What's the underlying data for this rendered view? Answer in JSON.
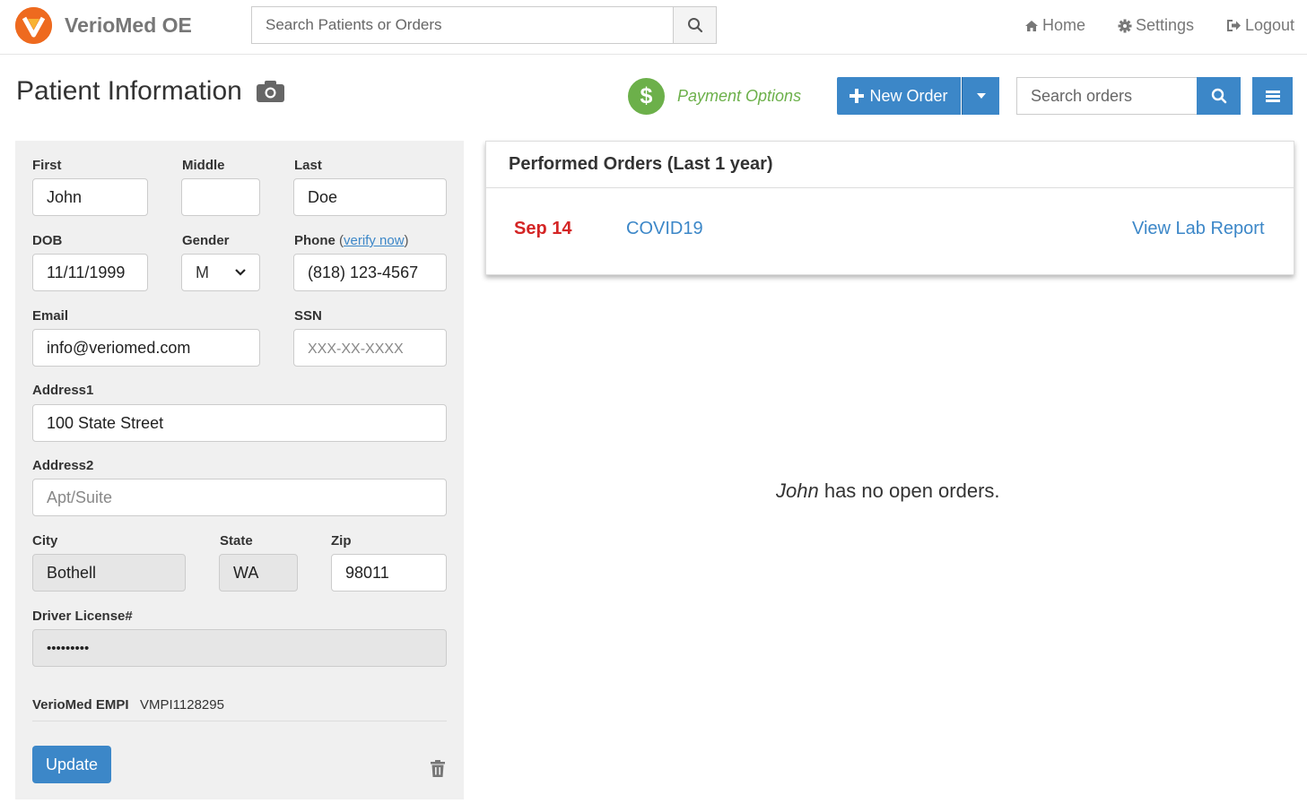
{
  "app": {
    "brand": "VerioMed OE"
  },
  "topbar": {
    "search_placeholder": "Search Patients or Orders",
    "nav": {
      "home": "Home",
      "settings": "Settings",
      "logout": "Logout"
    }
  },
  "header": {
    "title": "Patient Information",
    "payment_options": "Payment Options",
    "payment_icon": "$",
    "new_order": "New Order",
    "orders_search_placeholder": "Search orders"
  },
  "form": {
    "first": {
      "label": "First",
      "value": "John"
    },
    "middle": {
      "label": "Middle",
      "value": ""
    },
    "last": {
      "label": "Last",
      "value": "Doe"
    },
    "dob": {
      "label": "DOB",
      "value": "11/11/1999"
    },
    "gender": {
      "label": "Gender",
      "value": "M"
    },
    "phone": {
      "label": "Phone",
      "verify_open": "(",
      "verify_link": "verify now",
      "verify_close": ")",
      "value": "(818) 123-4567"
    },
    "email": {
      "label": "Email",
      "value": "info@veriomed.com"
    },
    "ssn": {
      "label": "SSN",
      "placeholder": "XXX-XX-XXXX"
    },
    "address1": {
      "label": "Address1",
      "value": "100 State Street"
    },
    "address2": {
      "label": "Address2",
      "placeholder": "Apt/Suite"
    },
    "city": {
      "label": "City",
      "value": "Bothell"
    },
    "state": {
      "label": "State",
      "value": "WA"
    },
    "zip": {
      "label": "Zip",
      "value": "98011"
    },
    "license": {
      "label": "Driver License#",
      "value": "•••••••••"
    },
    "empi": {
      "label": "VerioMed EMPI",
      "value": "VMPI1128295"
    },
    "update_label": "Update"
  },
  "performed_orders": {
    "title": "Performed Orders (Last 1 year)",
    "items": [
      {
        "date": "Sep 14",
        "test": "COVID19",
        "action": "View Lab Report"
      }
    ]
  },
  "open_orders": {
    "patient_name": "John",
    "message": " has no open orders."
  },
  "colors": {
    "primary": "#3c87c8",
    "payment_green": "#6cb04a",
    "date_red": "#d42525",
    "logo_orange": "#ee6a1f",
    "panel_bg": "#f0f0f0"
  }
}
